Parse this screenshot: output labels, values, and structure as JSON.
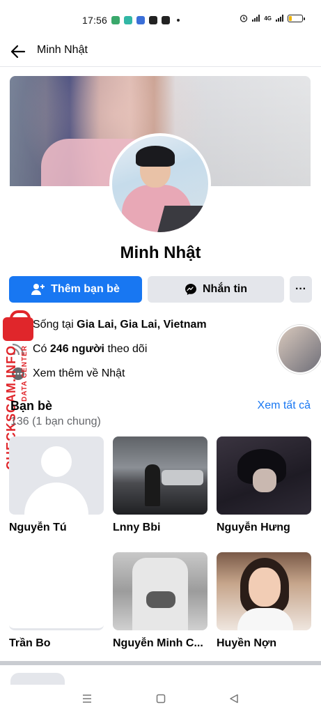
{
  "status_bar": {
    "time": "17:56",
    "network": "4G",
    "app_icon_colors": [
      "#3aa86b",
      "#32b7a5",
      "#3b6fd8",
      "#222222",
      "#222222"
    ]
  },
  "header": {
    "title": "Minh Nhật"
  },
  "profile": {
    "name": "Minh Nhật",
    "add_friend_label": "Thêm bạn bè",
    "message_label": "Nhắn tin",
    "more_label": "···"
  },
  "info": {
    "lives_prefix": "Sống tại ",
    "lives_in": "Gia Lai, Gia Lai, Vietnam",
    "followers_prefix": "Có ",
    "followers_count": "246 người",
    "followers_suffix": " theo dõi",
    "see_more": "Xem thêm về Nhật"
  },
  "watermark": {
    "text": "CHECKSCAM.INFO",
    "sub": "DATA CENTER"
  },
  "friends": {
    "title": "Bạn bè",
    "see_all": "Xem tất cả",
    "count": "136 (1 bạn chung)",
    "items": [
      {
        "name": "Nguyễn Tú"
      },
      {
        "name": "Lnny Bbi"
      },
      {
        "name": "Nguyễn Hưng"
      },
      {
        "name": "Trần Bo"
      },
      {
        "name": "Nguyễn Minh C..."
      },
      {
        "name": "Huyền Nợn"
      }
    ]
  },
  "colors": {
    "primary": "#1877f2",
    "secondary_bg": "#e4e6eb",
    "watermark": "#e0262b"
  }
}
